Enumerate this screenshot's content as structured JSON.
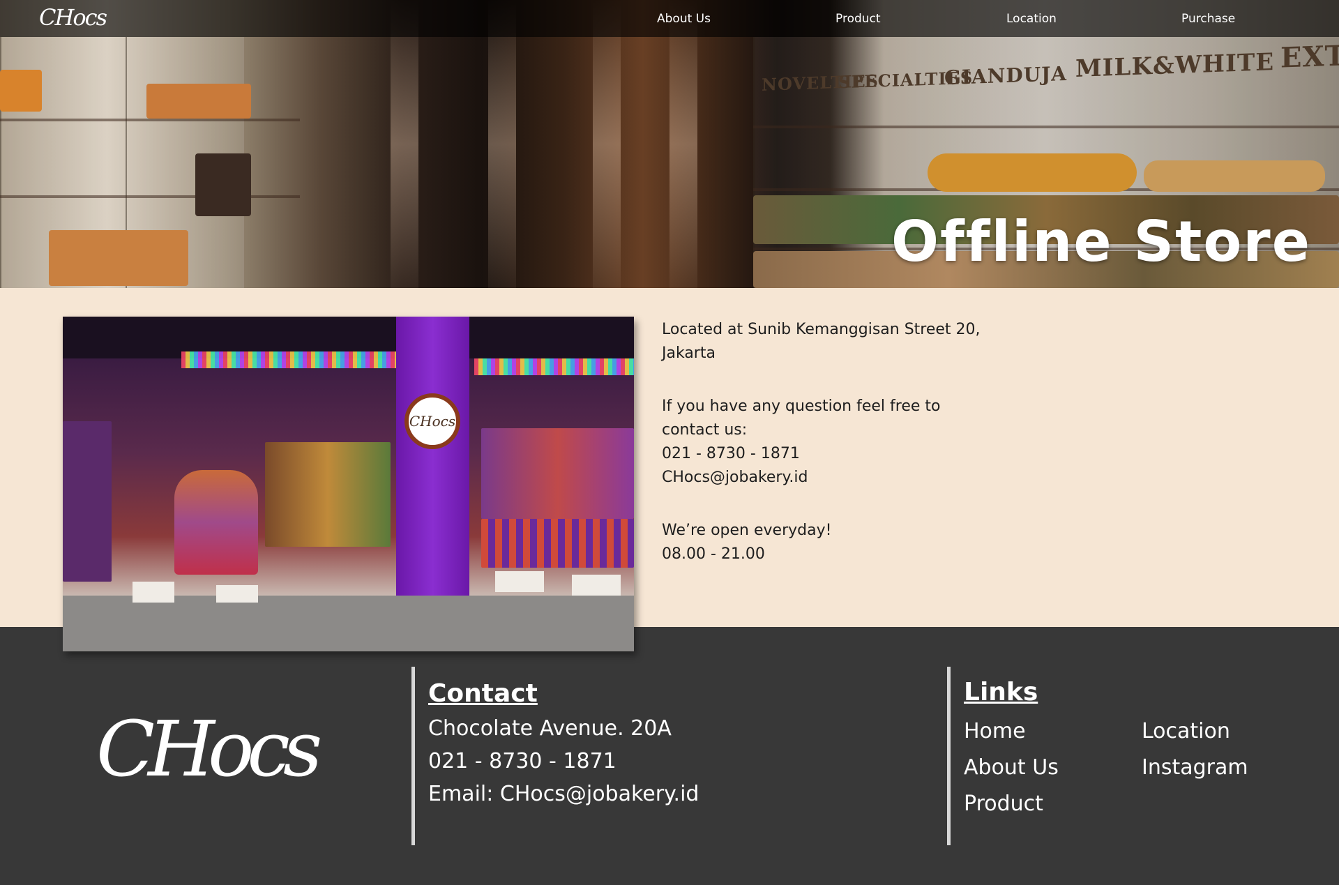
{
  "brand": {
    "logo_text": "CHocs"
  },
  "nav": {
    "items": [
      {
        "label": "About Us"
      },
      {
        "label": "Product"
      },
      {
        "label": "Location"
      },
      {
        "label": "Purchase"
      }
    ]
  },
  "hero": {
    "title": "Offline Store",
    "signs": [
      "NOVELTIES",
      "SPECIALTIES",
      "GIANDUJA",
      "MILK&WHITE",
      "EXT"
    ]
  },
  "store_photo": {
    "badge_text": "CHocs"
  },
  "info": {
    "address": "Located at Sunib Kemanggisan Street 20, Jakarta",
    "question": "If you have any question feel free to contact us:",
    "phone": "021 - 8730 - 1871",
    "email": "CHocs@jobakery.id",
    "open_text": "We’re open everyday!",
    "hours": "08.00 - 21.00"
  },
  "footer": {
    "logo_text": "CHocs",
    "contact": {
      "heading": "Contact",
      "address": "Chocolate Avenue. 20A",
      "phone": "021 - 8730 - 1871",
      "email": "Email: CHocs@jobakery.id"
    },
    "links": {
      "heading": "Links",
      "items": [
        {
          "label": "Home"
        },
        {
          "label": "About Us"
        },
        {
          "label": "Product"
        },
        {
          "label": "Location"
        },
        {
          "label": "Instagram"
        }
      ]
    }
  },
  "colors": {
    "page_bg": "#f6e6d4",
    "footer_bg": "#383838",
    "nav_bg": "rgba(0,0,0,0.62)",
    "text_dark": "#1e1e1e",
    "text_light": "#ffffff"
  }
}
